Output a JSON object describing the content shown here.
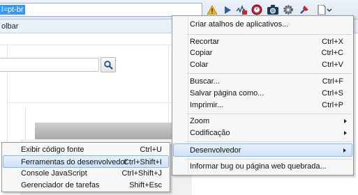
{
  "address_bar": {
    "url_fragment": "l=pt-br"
  },
  "bookmarks_bar": {
    "label_fragment": "olbar"
  },
  "toolbar_icons": [
    "warning-icon",
    "play-icon",
    "chart-extension-icon",
    "camera-icon",
    "gear-extension-icon",
    "pin-icon",
    "page-menu-icon"
  ],
  "main_menu": {
    "create_shortcuts": "Criar atalhos de aplicativos...",
    "cut": {
      "label": "Recortar",
      "shortcut": "Ctrl+X"
    },
    "copy": {
      "label": "Copiar",
      "shortcut": "Ctrl+C"
    },
    "paste": {
      "label": "Colar",
      "shortcut": "Ctrl+V"
    },
    "find": {
      "label": "Buscar...",
      "shortcut": "Ctrl+F"
    },
    "save_as": {
      "label": "Salvar página como...",
      "shortcut": "Ctrl+S"
    },
    "print": {
      "label": "Imprimir...",
      "shortcut": "Ctrl+P"
    },
    "zoom": {
      "label": "Zoom"
    },
    "encoding": {
      "label": "Codificação"
    },
    "developer": {
      "label": "Desenvolvedor"
    },
    "report_bug": "Informar bug ou página web quebrada..."
  },
  "developer_submenu": {
    "view_source": {
      "label": "Exibir código fonte",
      "shortcut": "Ctrl+U"
    },
    "dev_tools": {
      "label": "Ferramentas do desenvolvedor",
      "shortcut": "Ctrl+Shift+I"
    },
    "js_console": {
      "label": "Console JavaScript",
      "shortcut": "Ctrl+Shift+J"
    },
    "task_manager": {
      "label": "Gerenciador de tarefas",
      "shortcut": "Shift+Esc"
    }
  },
  "colors": {
    "selection": "#3399ff",
    "highlight": "#cfe2f8",
    "menu_bg": "#f7f7f7"
  }
}
